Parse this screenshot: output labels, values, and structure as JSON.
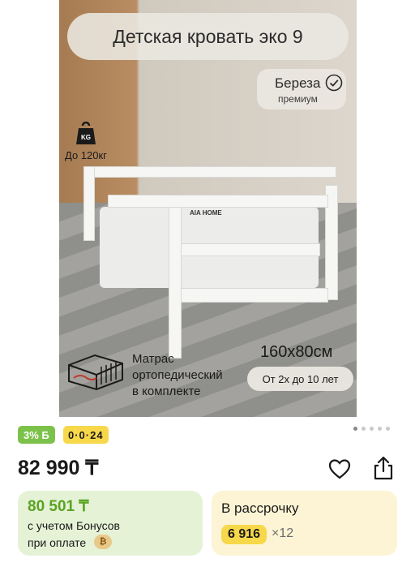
{
  "product_image": {
    "title": "Детская кровать эко 9",
    "wood": "Береза",
    "wood_grade": "премиум",
    "weight": "До 120кг",
    "kg_icon_text": "KG",
    "brand": "AIA HOME",
    "mattress_lines": [
      "Матрас",
      "ортопедический",
      "в комплекте"
    ],
    "size": "160x80см",
    "age": "От 2х до 10 лет"
  },
  "badges": {
    "cashback": "3% Б",
    "installment": "0·0·24"
  },
  "carousel": {
    "dots": 5,
    "active_index": 0
  },
  "price": {
    "main": "82 990 ₸"
  },
  "bonus": {
    "price": "80 501 ₸",
    "line1": "с учетом Бонусов",
    "line2": "при оплате",
    "coin_icon": "₿"
  },
  "installment": {
    "title": "В рассрочку",
    "amount": "6 916",
    "times": "×12"
  },
  "colors": {
    "green": "#7cc24a",
    "yellow": "#f7d84a",
    "bonus_bg": "#e5f2d6",
    "installment_bg": "#fcf4d4"
  }
}
